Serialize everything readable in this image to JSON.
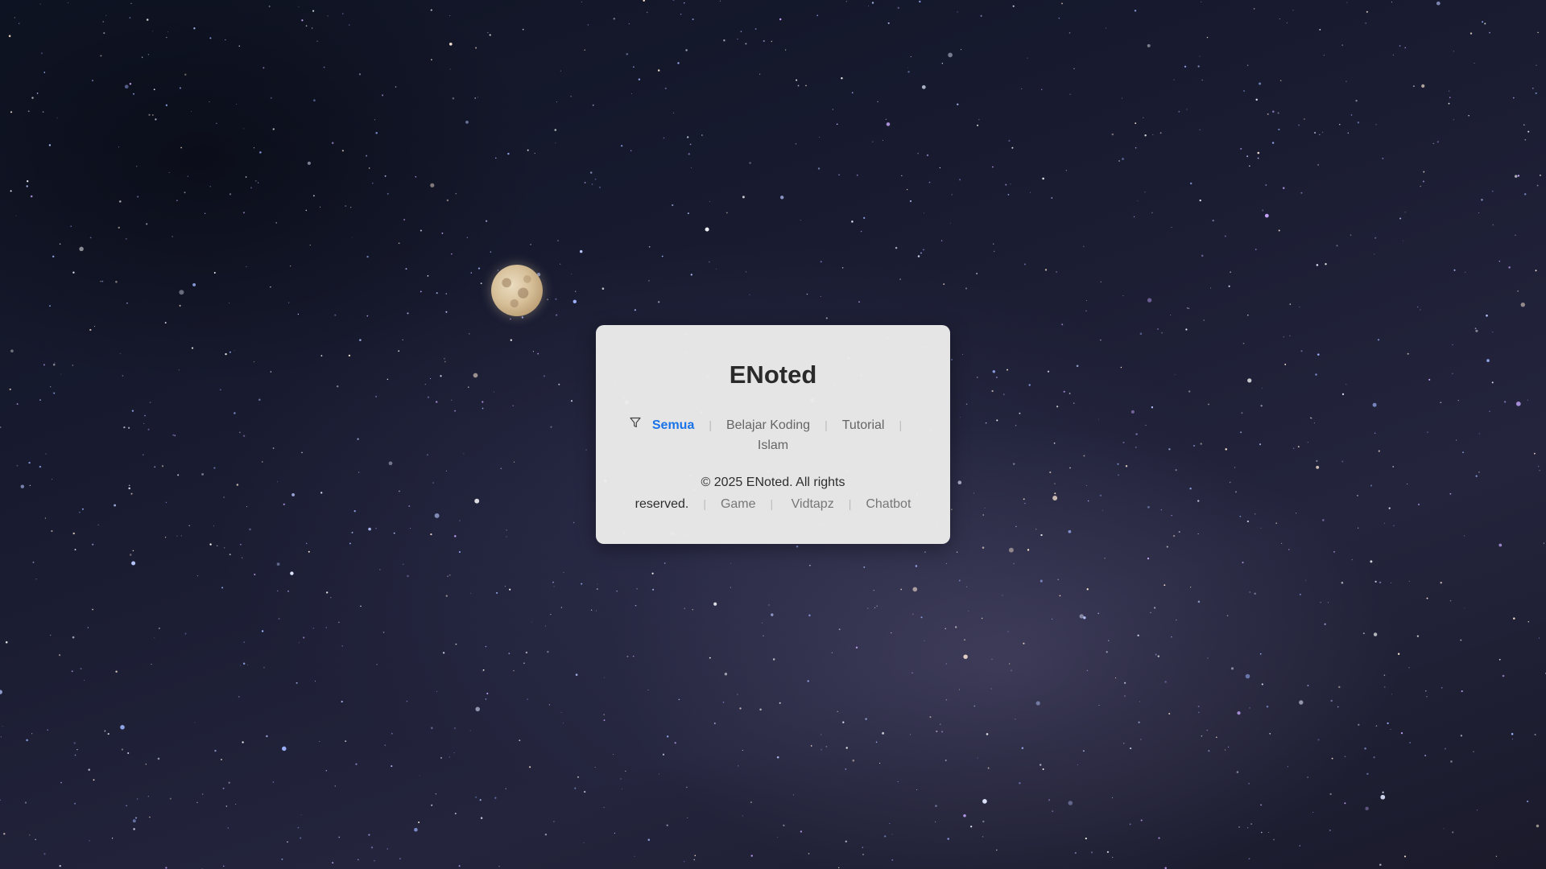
{
  "site": {
    "title": "ENoted"
  },
  "categories": {
    "icon": "filter-icon",
    "items": [
      {
        "label": "Semua",
        "active": true
      },
      {
        "label": "Belajar Koding",
        "active": false
      },
      {
        "label": "Tutorial",
        "active": false
      },
      {
        "label": "Islam",
        "active": false
      }
    ],
    "separator": "|"
  },
  "footer": {
    "copyright": "© 2025 ENoted. All rights reserved.",
    "links": [
      {
        "label": "Game"
      },
      {
        "label": "Vidtapz"
      },
      {
        "label": "Chatbot"
      }
    ],
    "separator": "|"
  },
  "colors": {
    "accent": "#1a73e8",
    "card_background": "#ebebeb",
    "text_muted": "#666666"
  }
}
